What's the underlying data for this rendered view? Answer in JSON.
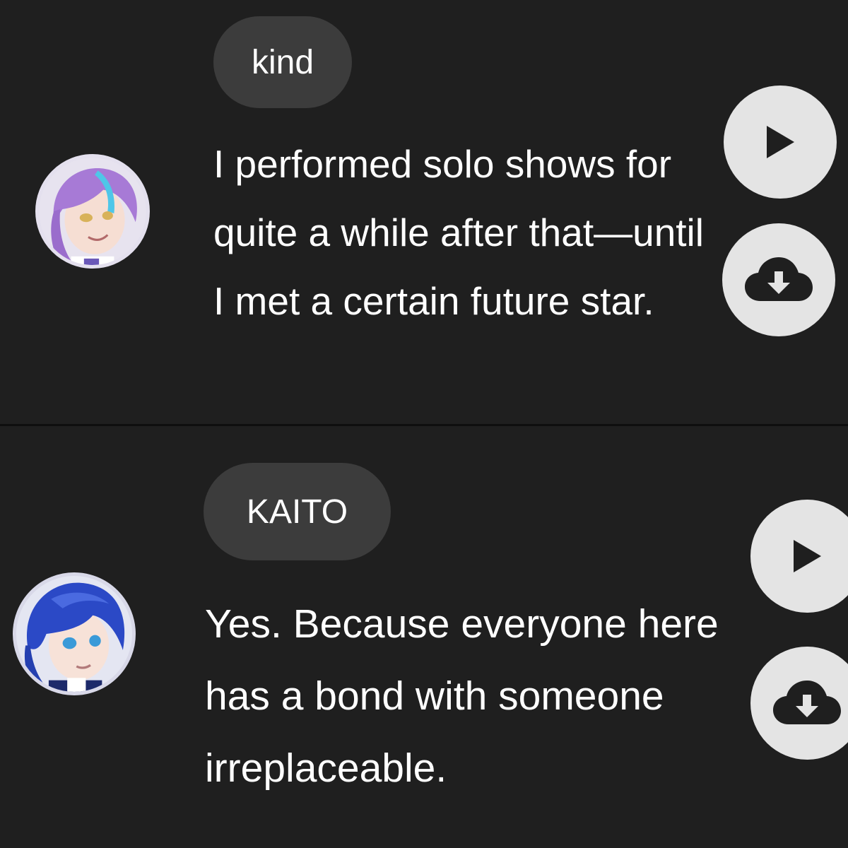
{
  "entries": [
    {
      "speaker": "kind",
      "text": "I performed solo shows for quite a while after that—until I met a certain future star.",
      "avatar_icon": "character-portrait-purple-hair",
      "play_icon": "play-icon",
      "download_icon": "cloud-download-icon"
    },
    {
      "speaker": "KAITO",
      "text": "Yes. Because everyone here has a bond with someone irreplaceable.",
      "avatar_icon": "character-portrait-blue-hair",
      "play_icon": "play-icon",
      "download_icon": "cloud-download-icon"
    }
  ],
  "colors": {
    "background": "#1f1f1f",
    "pill": "#3c3c3c",
    "button": "#e4e4e4",
    "icon": "#1f1f1f",
    "text": "#ffffff"
  }
}
